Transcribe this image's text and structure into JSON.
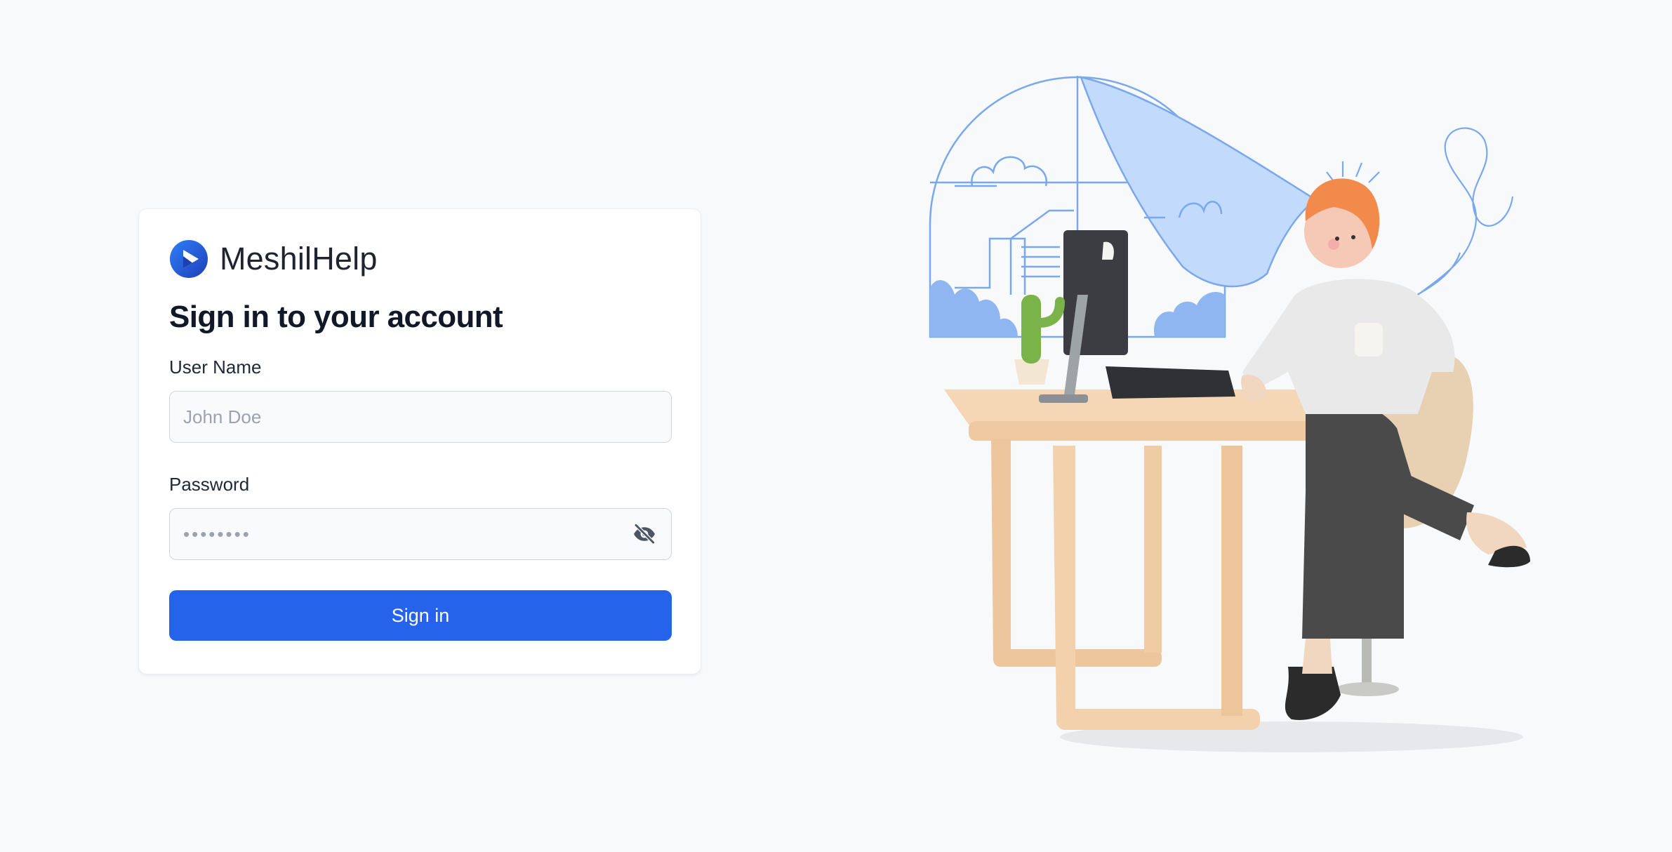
{
  "brand": {
    "name": "MeshilHelp",
    "color": "#2563eb"
  },
  "login": {
    "heading": "Sign in to your account",
    "username_label": "User Name",
    "username_placeholder": "John Doe",
    "username_value": "",
    "password_label": "Password",
    "password_placeholder": "••••••••",
    "password_value": "",
    "password_toggle_icon": "eye-slash-icon",
    "submit_label": "Sign in"
  },
  "colors": {
    "page_background": "#f8f9fb",
    "primary": "#2563eb",
    "illustration_line": "#7aa8ee",
    "illustration_fill": "#c2dafb"
  }
}
